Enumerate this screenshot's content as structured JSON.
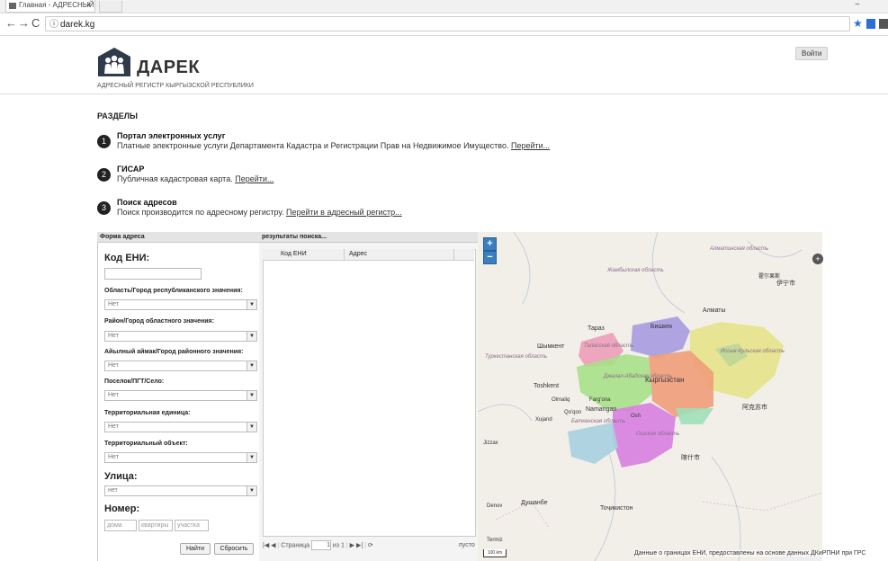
{
  "browser": {
    "tab_title": "Главная - АДРЕСНЫЙ Р",
    "tab_close": "×",
    "url": "darek.kg",
    "nav_back": "←",
    "nav_forward": "→",
    "nav_reload": "C",
    "info_icon": "ⓘ",
    "star": "★"
  },
  "header": {
    "brand": "ДАРЕК",
    "subtitle": "АДРЕСНЫЙ РЕГИСТР КЫРГЫЗСКОЙ РЕСПУБЛИКИ",
    "login": "Войти"
  },
  "sections": {
    "title": "РАЗДЕЛЫ",
    "items": [
      {
        "num": "1",
        "title": "Портал электронных услуг",
        "desc": "Платные электронные услуги Департамента Кадастра и Регистрации Прав на Недвижимое Имущество.",
        "link": "Перейти..."
      },
      {
        "num": "2",
        "title": "ГИСАР",
        "desc": "Публичная кадастровая карта.",
        "link": "Перейти..."
      },
      {
        "num": "3",
        "title": "Поиск адресов",
        "desc": "Поиск производится по адресному регистру.",
        "link": "Перейти в адресный регистр..."
      }
    ]
  },
  "form": {
    "header": "Форма адреса",
    "eni_label": "Код ЕНИ:",
    "fields": [
      {
        "label": "Область/Город республиканского значения:",
        "value": "Нет"
      },
      {
        "label": "Район/Город областного значения:",
        "value": "Нет"
      },
      {
        "label": "Айылный аймак/Город районного значения:",
        "value": "Нет"
      },
      {
        "label": "Поселок/ПГТ/Село:",
        "value": "Нет"
      },
      {
        "label": "Территориальная единица:",
        "value": "Нет"
      },
      {
        "label": "Территориальный объект:",
        "value": "Нет"
      }
    ],
    "street_label": "Улица:",
    "street_value": "нет",
    "number_label": "Номер:",
    "house_placeholder": "дома",
    "apt_placeholder": "квартиры",
    "plot_placeholder": "участка",
    "find_button": "Найти",
    "reset_button": "Сбросить"
  },
  "results": {
    "header": "результаты поиска...",
    "columns": [
      "Код ЕНИ",
      "Адрес"
    ],
    "pager": {
      "first": "|◀",
      "prev": "◀",
      "page_label": "Страница",
      "page_value": "1",
      "of": "из 1",
      "next": "▶",
      "last": "▶|",
      "refresh": "⟳"
    },
    "empty": "пусто"
  },
  "map": {
    "zoom_in": "+",
    "zoom_out": "−",
    "layers": "+",
    "scale": "100 km",
    "attribution": "Данные о границах ЕНИ, предоставлены на основе данных ДКиРПНИ при ГРС",
    "cities": [
      "Алматы",
      "Бишкек",
      "Тараз",
      "Шымкент",
      "Toshkent",
      "Namangan",
      "Кыргызстан",
      "Душанбе",
      "Тоҷикистон",
      "Olmaliq",
      "Farg'ona",
      "Qo'qon",
      "Xujand",
      "Jizzax",
      "Osh",
      "Denov",
      "Termiz",
      "阿克苏市",
      "喀什市",
      "伊宁市",
      "霍尔果斯"
    ],
    "regions": [
      "Алматинская область",
      "Жамбылская область",
      "Таласская область",
      "Туркестанская область",
      "Джалал-Абадская область",
      "Иссык-Кульская область",
      "Баткенская область",
      "Ошская область"
    ]
  }
}
